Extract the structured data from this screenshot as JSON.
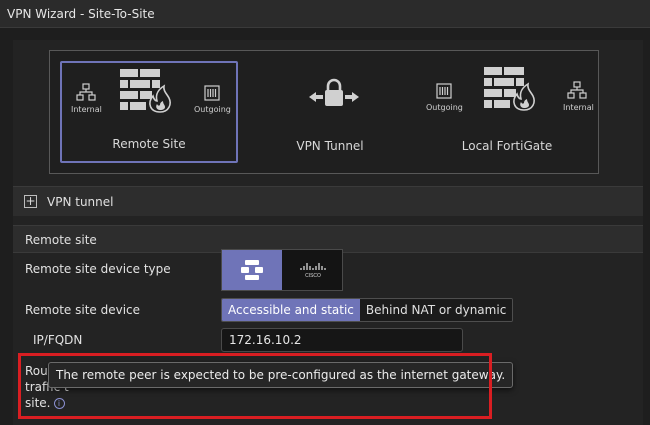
{
  "window": {
    "title": "VPN Wizard - Site-To-Site"
  },
  "topology": {
    "remote_site": {
      "label": "Remote Site",
      "left_label": "Internal",
      "right_label": "Outgoing"
    },
    "tunnel": {
      "label": "VPN Tunnel"
    },
    "local": {
      "label": "Local FortiGate",
      "left_label": "Outgoing",
      "right_label": "Internal"
    }
  },
  "sections": {
    "vpn_tunnel": "VPN tunnel",
    "remote_site": "Remote site"
  },
  "form": {
    "device_type_label": "Remote site device type",
    "device_type_options": [
      "FortiGate",
      "Cisco"
    ],
    "device_type_selected": "FortiGate",
    "device_label": "Remote site device",
    "device_options": [
      "Accessible and static",
      "Behind NAT or dynamic"
    ],
    "device_selected": "Accessible and static",
    "ip_label": "IP/FQDN",
    "ip_value": "172.16.10.2",
    "route_line1": "Route t",
    "route_line2": "traffic t",
    "route_line3": "site."
  },
  "tooltip": {
    "text": "The remote peer is expected to be pre-configured as the internet gateway."
  },
  "colors": {
    "accent": "#6f74b8",
    "highlight": "#d91e22",
    "background": "#1e1e1e"
  },
  "icons": {
    "internal": "network-topology-icon",
    "outgoing": "switch-ports-icon",
    "firewall": "firewall-flame-icon",
    "tunnel": "lock-arrows-icon"
  }
}
